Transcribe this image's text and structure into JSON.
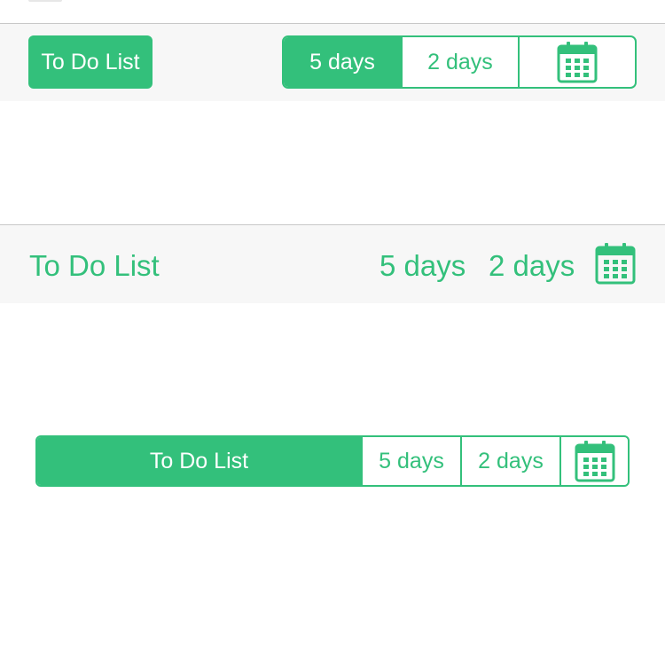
{
  "colors": {
    "accent": "#33c07b",
    "bar_bg": "#f7f7f7",
    "divider": "#c8c8c8"
  },
  "toolbar_boxed": {
    "todo_label": "To Do List",
    "segments": [
      "5 days",
      "2 days"
    ],
    "selected": "5 days",
    "calendar_icon": "calendar-icon"
  },
  "toolbar_plain": {
    "todo_label": "To Do List",
    "five_days": "5 days",
    "two_days": "2 days",
    "calendar_icon": "calendar-icon"
  },
  "segmented_full": {
    "todo_label": "To Do List",
    "five_days": "5 days",
    "two_days": "2 days",
    "selected": "To Do List",
    "calendar_icon": "calendar-icon"
  }
}
